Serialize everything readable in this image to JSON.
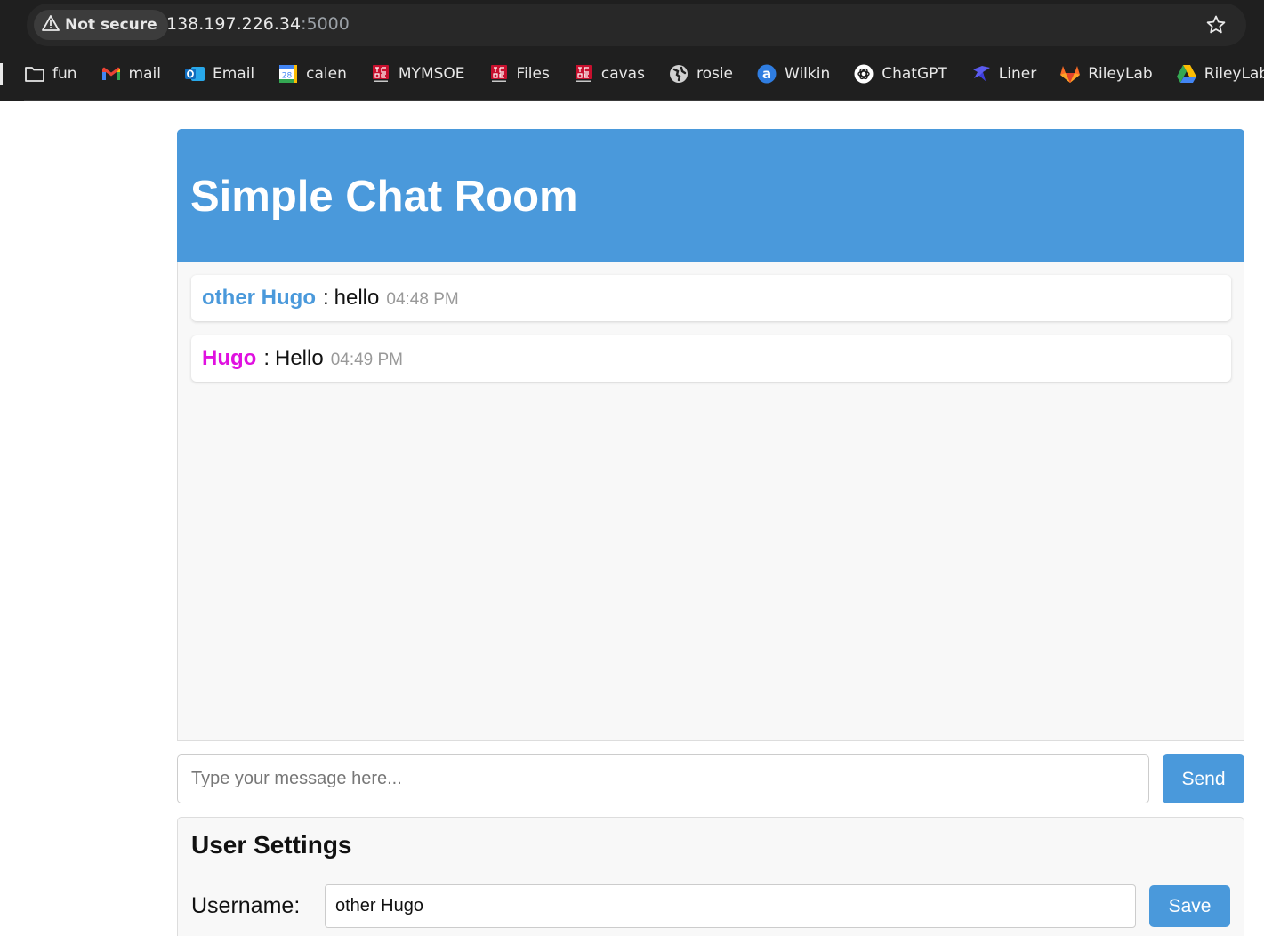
{
  "browser": {
    "security_label": "Not secure",
    "url_host": "138.197.226.34",
    "url_port": ":5000",
    "bookmarks": [
      {
        "label": "fun",
        "icon": "folder-icon"
      },
      {
        "label": "mail",
        "icon": "gmail-icon"
      },
      {
        "label": "Email",
        "icon": "outlook-icon"
      },
      {
        "label": "calen",
        "icon": "calendar-icon",
        "icon_text": "28"
      },
      {
        "label": "MYMSOE",
        "icon": "msoe-icon"
      },
      {
        "label": "Files",
        "icon": "msoe-icon"
      },
      {
        "label": "cavas",
        "icon": "msoe-icon"
      },
      {
        "label": "rosie",
        "icon": "globe-icon"
      },
      {
        "label": "Wilkin",
        "icon": "wilkin-icon"
      },
      {
        "label": "ChatGPT",
        "icon": "chatgpt-icon"
      },
      {
        "label": "Liner",
        "icon": "liner-icon"
      },
      {
        "label": "RileyLab",
        "icon": "gitlab-icon"
      },
      {
        "label": "RileyLab - Goo",
        "icon": "google-drive-icon"
      }
    ]
  },
  "app": {
    "title": "Simple Chat Room",
    "messages": [
      {
        "user": "other Hugo",
        "separator": ":",
        "text": "hello",
        "time": "04:48 PM",
        "user_color": "#4a99db"
      },
      {
        "user": "Hugo",
        "separator": ":",
        "text": "Hello",
        "time": "04:49 PM",
        "user_color": "#e010e0"
      }
    ],
    "composer": {
      "placeholder": "Type your message here...",
      "value": "",
      "send_label": "Send"
    },
    "settings": {
      "title": "User Settings",
      "username_label": "Username:",
      "username_value": "other Hugo",
      "save_label": "Save"
    }
  },
  "colors": {
    "accent": "#4a99db",
    "chat_background": "#f8f8f8",
    "chrome_background": "#1f1f1f"
  }
}
